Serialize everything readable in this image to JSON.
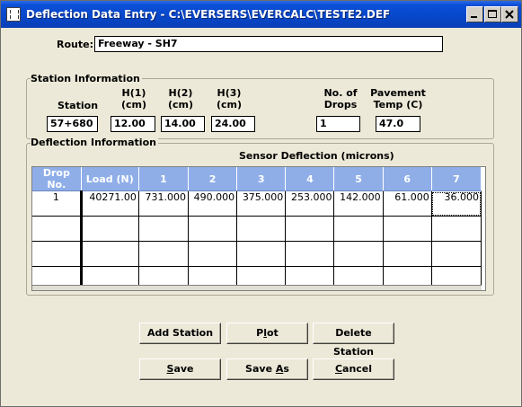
{
  "window": {
    "title": "Deflection Data Entry - C:\\EVERSERS\\EVERCALC\\TESTE2.DEF",
    "minimize_label": "_",
    "maximize_label": "□",
    "close_label": "✕"
  },
  "route": {
    "label": "Route:",
    "value": "Freeway - SH7"
  },
  "station_info": {
    "group_title": "Station Information",
    "station_label": "Station",
    "h1_label": "H(1)\n(cm)",
    "h2_label": "H(2)\n(cm)",
    "h3_label": "H(3)\n(cm)",
    "drops_label": "No. of\nDrops",
    "temp_label": "Pavement\nTemp (C)",
    "station_value": "57+680",
    "h1_value": "12.00",
    "h2_value": "14.00",
    "h3_value": "24.00",
    "drops_value": "1",
    "temp_value": "47.0"
  },
  "deflection_info": {
    "group_title": "Deflection Information",
    "sensor_caption": "Sensor Deflection (microns)",
    "columns": [
      "Drop No.",
      "Load (N)",
      "1",
      "2",
      "3",
      "4",
      "5",
      "6",
      "7"
    ],
    "rows": [
      [
        "1",
        "40271.00",
        "731.000",
        "490.000",
        "375.000",
        "253.000",
        "142.000",
        "61.000",
        "36.000"
      ],
      [
        "",
        "",
        "",
        "",
        "",
        "",
        "",
        "",
        ""
      ],
      [
        "",
        "",
        "",
        "",
        "",
        "",
        "",
        "",
        ""
      ],
      [
        "",
        "",
        "",
        "",
        "",
        "",
        "",
        "",
        ""
      ],
      [
        "",
        "",
        "",
        "",
        "",
        "",
        "",
        "",
        ""
      ]
    ]
  },
  "buttons": {
    "add_station": "Add Station",
    "plot_pre": "P",
    "plot_ul": "l",
    "plot_post": "ot",
    "delete_station": "Delete Station",
    "save_pre": "",
    "save_ul": "S",
    "save_post": "ave",
    "save_as_pre": "Save ",
    "save_as_ul": "A",
    "save_as_post": "s",
    "cancel_pre": "",
    "cancel_ul": "C",
    "cancel_post": "ancel"
  }
}
